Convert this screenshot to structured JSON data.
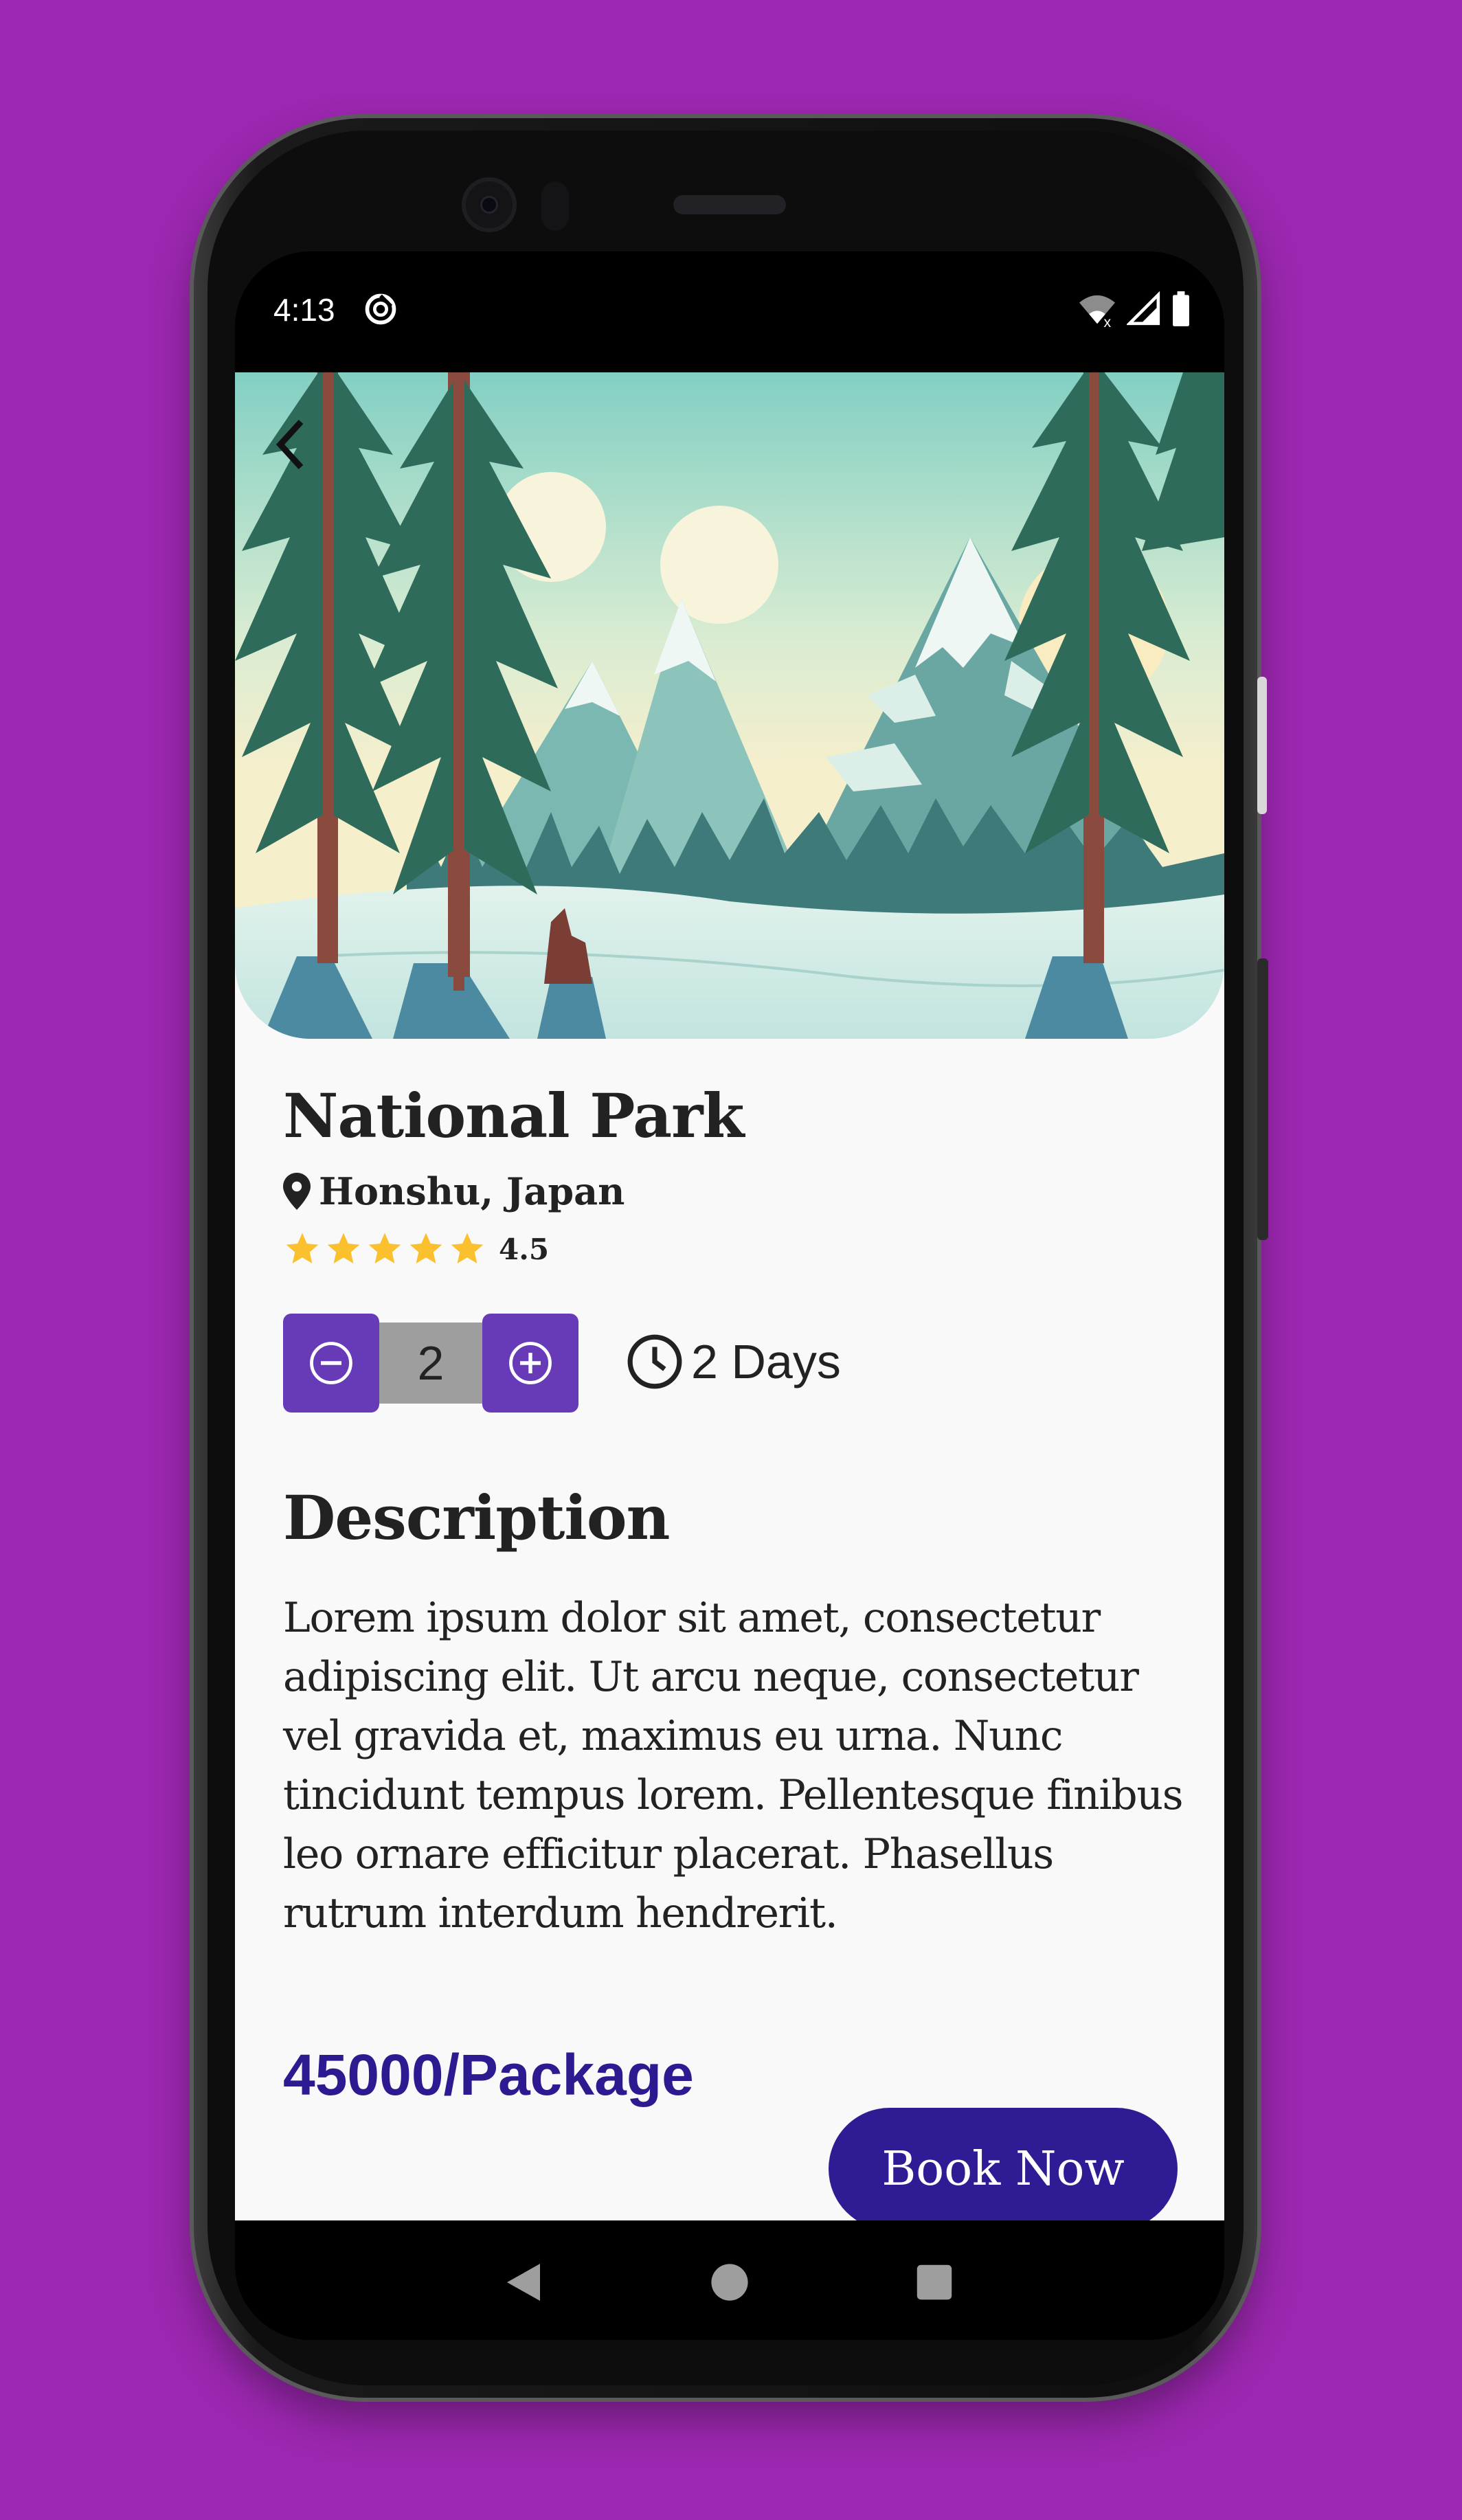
{
  "status_bar": {
    "time": "4:13",
    "icons": [
      "dnd-icon",
      "wifi-off-icon",
      "signal-icon",
      "battery-icon"
    ]
  },
  "hero": {
    "image": "snowy-mountains-forest-illustration",
    "back_icon": "chevron-left-icon"
  },
  "place": {
    "title": "National Park",
    "location": "Honshu, Japan",
    "location_icon": "map-pin-icon",
    "rating": 4.5,
    "rating_text": "4.5",
    "star_count": 5
  },
  "stepper": {
    "value": "2",
    "minus_icon": "minus-circle-icon",
    "plus_icon": "plus-circle-icon"
  },
  "duration": {
    "icon": "clock-icon",
    "text": "2 Days"
  },
  "description": {
    "heading": "Description",
    "body": "Lorem ipsum dolor sit amet, consectetur adipiscing elit. Ut arcu neque, consectetur vel gravida et, maximus eu urna. Nunc tincidunt tempus lorem. Pellentesque finibus leo ornare efficitur placerat. Phasellus rutrum interdum hendrerit."
  },
  "footer": {
    "price": "45000/Package",
    "book_label": "Book Now"
  },
  "colors": {
    "background": "#9c27b0",
    "accent": "#673ab7",
    "primary_dark": "#2f1c94",
    "star": "#fbc02d"
  },
  "nav": [
    "back-nav-icon",
    "home-nav-icon",
    "recents-nav-icon"
  ]
}
